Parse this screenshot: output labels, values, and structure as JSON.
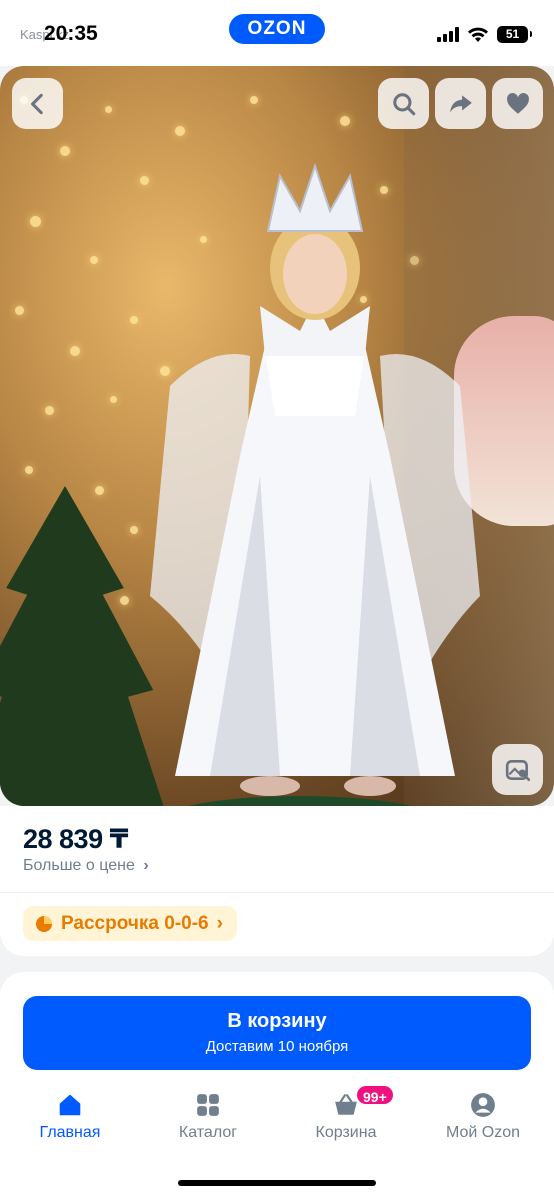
{
  "status": {
    "time": "20:35",
    "back_hint": "Kaspi.kz",
    "battery": "51"
  },
  "app_logo": "OZON",
  "photo": {
    "back_icon": "chevron-left-icon",
    "search_icon": "search-icon",
    "share_icon": "share-icon",
    "favorite_icon": "heart-icon",
    "visual_search_icon": "image-search-icon"
  },
  "product": {
    "price": "28 839 ₸",
    "price_more": "Больше о цене",
    "installment": "Рассрочка 0-0-6"
  },
  "cart_button": {
    "title": "В корзину",
    "delivery": "Доставим 10 ноября"
  },
  "tabbar": {
    "items": [
      {
        "label": "Главная",
        "icon": "home-icon"
      },
      {
        "label": "Каталог",
        "icon": "catalog-icon"
      },
      {
        "label": "Корзина",
        "icon": "cart-icon",
        "badge": "99+"
      },
      {
        "label": "Мой Ozon",
        "icon": "profile-icon"
      }
    ]
  },
  "colors": {
    "brand": "#005bff",
    "badge": "#f1117e",
    "installment": "#e87b00"
  }
}
